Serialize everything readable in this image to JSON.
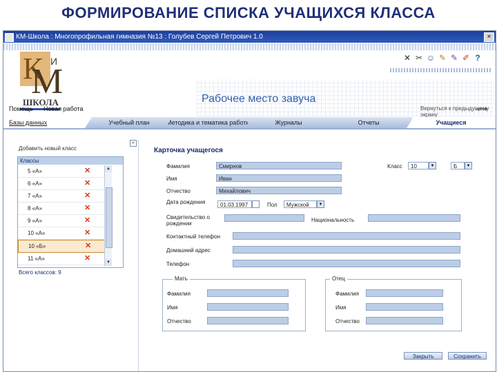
{
  "slide": {
    "title": "ФОРМИРОВАНИЕ СПИСКА УЧАЩИХСЯ КЛАССА"
  },
  "window": {
    "title": "КМ-Школа : Многопрофильная гимназия №13 : Голубев Сергей Петрович 1.0"
  },
  "logo": {
    "letter_k": "К",
    "letter_m": "М",
    "letter_i": "И",
    "text": "ШКОЛА"
  },
  "toolbar": {
    "icons": [
      "close-icon",
      "scissors-icon",
      "users-icon",
      "pencil-icon",
      "edit-icon",
      "edit-user-icon",
      "help-icon"
    ]
  },
  "header": {
    "workspace_title": "Рабочее место завуча"
  },
  "menu": {
    "help": "Помощь",
    "new_work": "Новая работа",
    "back_hint": "Вернуться к предыдущему экрану"
  },
  "tabs": {
    "data": "Базы данных",
    "items": [
      "Учебный план",
      "Методика и тематика работы",
      "Журналы",
      "Отчеты",
      "Учащиеся"
    ],
    "active": "Учащиеся"
  },
  "left_panel": {
    "header": "Добавить новый класс",
    "list_header": "Классы",
    "classes": [
      "5 «А»",
      "6 «А»",
      "7 «А»",
      "8 «А»",
      "9 «А»",
      "10 «А»",
      "10 «Б»",
      "11 «А»"
    ],
    "selected": "10 «Б»",
    "total_label": "Всего классов: 9",
    "delete_glyph": "✕"
  },
  "card": {
    "title": "Карточка учащегося",
    "surname_label": "Фамилия",
    "surname_value": "Смирнов",
    "name_label": "Имя",
    "name_value": "Иван",
    "patronymic_label": "Отчество",
    "patronymic_value": "Михайлович",
    "class_label": "Класс",
    "class_number": "10",
    "class_letter": "Б",
    "birth_label": "Дата рождения",
    "birth_value": "01.03.1997",
    "gender_label": "Пол",
    "gender_value": "Мужской",
    "birth_cert_label": "Свидетельство о рождении",
    "nationality_label": "Национальность",
    "home_phone_label": "Контактный телефон",
    "address_label": "Домашний адрес",
    "phone_label": "Телефон",
    "mother": {
      "legend": "Мать",
      "surname": "Фамилия",
      "name": "Имя",
      "patronymic": "Отчество"
    },
    "father": {
      "legend": "Отец",
      "surname": "Фамилия",
      "name": "Имя",
      "patronymic": "Отчество"
    },
    "close_button": "Закрыть",
    "save_button": "Сохранить"
  },
  "colors": {
    "accent": "#2e5fae",
    "title": "#1f2f78",
    "field": "#bccde6",
    "delete": "#d43a1a"
  }
}
